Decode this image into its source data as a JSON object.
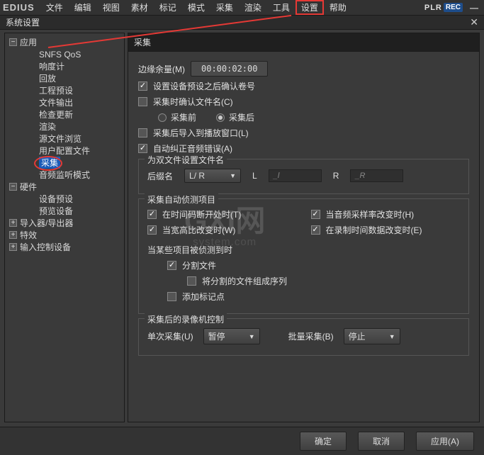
{
  "menubar": {
    "logo": "EDIUS",
    "items": [
      "文件",
      "编辑",
      "视图",
      "素材",
      "标记",
      "模式",
      "采集",
      "渲染",
      "工具",
      "设置",
      "帮助"
    ],
    "highlighted_index": 9,
    "plr": "PLR",
    "rec": "REC"
  },
  "window": {
    "title": "系统设置"
  },
  "tree": {
    "app": {
      "label": "应用",
      "expanded": true
    },
    "app_children": [
      "SNFS QoS",
      "响度计",
      "回放",
      "工程预设",
      "文件输出",
      "检查更新",
      "渲染",
      "源文件浏览",
      "用户配置文件",
      "采集",
      "音频监听模式"
    ],
    "selected_index": 9,
    "hardware": {
      "label": "硬件",
      "expanded": true
    },
    "hardware_children": [
      "设备预设",
      "预览设备"
    ],
    "importer": {
      "label": "导入器/导出器",
      "expanded": false
    },
    "effects": {
      "label": "特效",
      "expanded": false
    },
    "input_ctrl": {
      "label": "输入控制设备",
      "expanded": false
    }
  },
  "panel": {
    "title": "采集",
    "margin_label": "边缘余量(M)",
    "margin_value": "00:00:02:00",
    "chk_confirm_reel": "设置设备预设之后确认卷号",
    "chk_confirm_filename": "采集时确认文件名(C)",
    "radio_before": "采集前",
    "radio_after": "采集后",
    "chk_import_play": "采集后导入到播放窗口(L)",
    "chk_auto_audio": "自动纠正音频错误(A)",
    "fs_dual": {
      "legend": "为双文件设置文件名",
      "suffix_label": "后缀名",
      "suffix_combo": "L/ R",
      "l_label": "L",
      "l_value": "_l",
      "r_label": "R",
      "r_value": "_R"
    },
    "fs_detect": {
      "legend": "采集自动侦测项目",
      "chk_tc_break": "在时间码断开处时(T)",
      "chk_aspect": "当宽高比改变时(W)",
      "chk_audio_rate": "当音频采样率改变时(H)",
      "chk_rec_data": "在录制时间数据改变时(E)",
      "sub_label": "当某些项目被侦测到时",
      "chk_split": "分割文件",
      "chk_sequence": "将分割的文件组成序列",
      "chk_marker": "添加标记点"
    },
    "fs_vcr": {
      "legend": "采集后的录像机控制",
      "single_label": "单次采集(U)",
      "single_value": "暂停",
      "batch_label": "批量采集(B)",
      "batch_value": "停止"
    }
  },
  "footer": {
    "ok": "确定",
    "cancel": "取消",
    "apply": "应用(A)"
  },
  "watermark": {
    "main": "GXI网",
    "sub": "system.com"
  }
}
